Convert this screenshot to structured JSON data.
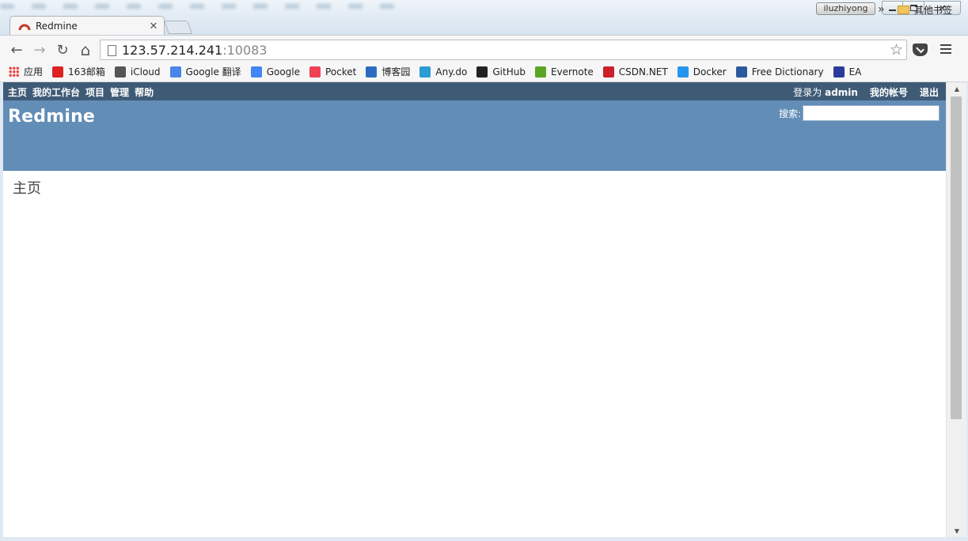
{
  "browser": {
    "profile_name": "iluzhiyong",
    "tab_title": "Redmine",
    "tab_close": "✕",
    "url_host": "123.57.214.241",
    "url_port": ":10083",
    "back_glyph": "←",
    "forward_glyph": "→",
    "reload_glyph": "↻",
    "home_glyph": "⌂",
    "star_glyph": "☆",
    "close_window_glyph": "✕"
  },
  "bookmarks": [
    {
      "label": "应用",
      "icon": "apps-grid-icon",
      "color": "#e44"
    },
    {
      "label": "163邮箱",
      "icon": "mail-163-icon",
      "color": "#d22"
    },
    {
      "label": "iCloud",
      "icon": "apple-icon",
      "color": "#555"
    },
    {
      "label": "Google 翻译",
      "icon": "translate-icon",
      "color": "#4a86e8"
    },
    {
      "label": "Google",
      "icon": "google-icon",
      "color": "#4285f4"
    },
    {
      "label": "Pocket",
      "icon": "pocket-icon",
      "color": "#ef4056"
    },
    {
      "label": "博客园",
      "icon": "cnblogs-icon",
      "color": "#2b6cc2"
    },
    {
      "label": "Any.do",
      "icon": "anydo-icon",
      "color": "#2c9bd6"
    },
    {
      "label": "GitHub",
      "icon": "github-icon",
      "color": "#222"
    },
    {
      "label": "Evernote",
      "icon": "evernote-icon",
      "color": "#5ba525"
    },
    {
      "label": "CSDN.NET",
      "icon": "csdn-icon",
      "color": "#c9202b"
    },
    {
      "label": "Docker",
      "icon": "docker-icon",
      "color": "#2496ed"
    },
    {
      "label": "Free Dictionary",
      "icon": "dictionary-icon",
      "color": "#2a5a9c"
    },
    {
      "label": "EA",
      "icon": "ea-icon",
      "color": "#2b3a9c"
    }
  ],
  "bookmarks_more": "»",
  "bookmarks_folder": "其他书签",
  "redmine": {
    "top_menu": [
      "主页",
      "我的工作台",
      "项目",
      "管理",
      "帮助"
    ],
    "logged_as_prefix": "登录为 ",
    "logged_as_user": "admin",
    "my_account": "我的帐号",
    "logout": "退出",
    "site_title": "Redmine",
    "search_label": "搜索:",
    "search_value": "",
    "page_heading": "主页"
  },
  "colors": {
    "top_menu_bg": "#3e5b76",
    "header_bg": "#628db6",
    "tab_favicon": "#c0392b"
  }
}
